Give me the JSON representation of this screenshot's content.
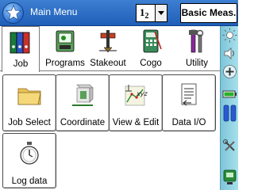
{
  "window": {
    "title": "Main Menu"
  },
  "toolbar": {
    "fraction_value": "1/2",
    "fraction_display_num": "1",
    "fraction_display_den": "2",
    "basic_meas_label": "Basic Meas."
  },
  "tabs": [
    {
      "label": "Job",
      "icon": "binders-icon",
      "active": true
    },
    {
      "label": "Programs",
      "icon": "programs-icon",
      "active": false
    },
    {
      "label": "Stakeout",
      "icon": "stakeout-icon",
      "active": false
    },
    {
      "label": "Cogo",
      "icon": "calculator-icon",
      "active": false
    },
    {
      "label": "Utility",
      "icon": "tools-icon",
      "active": false
    }
  ],
  "job_items": [
    {
      "label": "Job Select",
      "icon": "folder-icon"
    },
    {
      "label": "Coordinate",
      "icon": "coordinate-icon"
    },
    {
      "label": "View & Edit",
      "icon": "view-edit-icon"
    },
    {
      "label": "Data I/O",
      "icon": "data-io-icon"
    },
    {
      "label": "Log data",
      "icon": "stopwatch-icon"
    }
  ],
  "sidebar": {
    "icons": [
      "sun-icon",
      "volume-icon",
      "plus-icon",
      "battery-icon",
      "double-battery-icon",
      "tools-icon",
      "station-icon"
    ]
  },
  "colors": {
    "titlebar": "#1f5fb8",
    "sidebar": "#a8e0ec",
    "accent": "#2a6fd0"
  }
}
